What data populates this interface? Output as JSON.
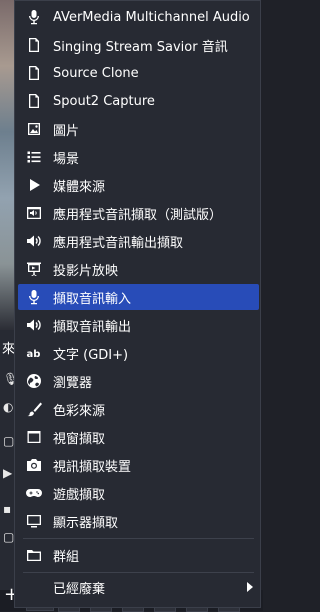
{
  "menu": {
    "items": [
      {
        "label": "AVerMedia Multichannel Audio",
        "icon": "microphone-icon"
      },
      {
        "label": "Singing Stream Savior 音訊",
        "icon": "document-icon"
      },
      {
        "label": "Source Clone",
        "icon": "document-icon"
      },
      {
        "label": "Spout2 Capture",
        "icon": "document-icon"
      },
      {
        "label": "圖片",
        "icon": "image-icon"
      },
      {
        "label": "場景",
        "icon": "list-icon"
      },
      {
        "label": "媒體來源",
        "icon": "play-icon"
      },
      {
        "label": "應用程式音訊擷取（測試版）",
        "icon": "window-speaker-icon"
      },
      {
        "label": "應用程式音訊輸出擷取",
        "icon": "speaker-icon"
      },
      {
        "label": "投影片放映",
        "icon": "slideshow-icon"
      },
      {
        "label": "擷取音訊輸入",
        "icon": "microphone-icon"
      },
      {
        "label": "擷取音訊輸出",
        "icon": "speaker-icon"
      },
      {
        "label": "文字 (GDI+)",
        "icon": "text-icon"
      },
      {
        "label": "瀏覽器",
        "icon": "globe-icon"
      },
      {
        "label": "色彩來源",
        "icon": "brush-icon"
      },
      {
        "label": "視窗擷取",
        "icon": "window-icon"
      },
      {
        "label": "視訊擷取裝置",
        "icon": "camera-icon"
      },
      {
        "label": "遊戲擷取",
        "icon": "gamepad-icon"
      },
      {
        "label": "顯示器擷取",
        "icon": "monitor-icon"
      },
      {
        "label": "群組",
        "icon": "folder-icon"
      },
      {
        "label": "已經廢棄",
        "icon": ""
      }
    ],
    "selected_index": 10
  },
  "background": {
    "dock_label": "來"
  },
  "colors": {
    "menu_bg": "#272a33",
    "selected_bg": "#284cb8",
    "text": "#ffffff"
  }
}
